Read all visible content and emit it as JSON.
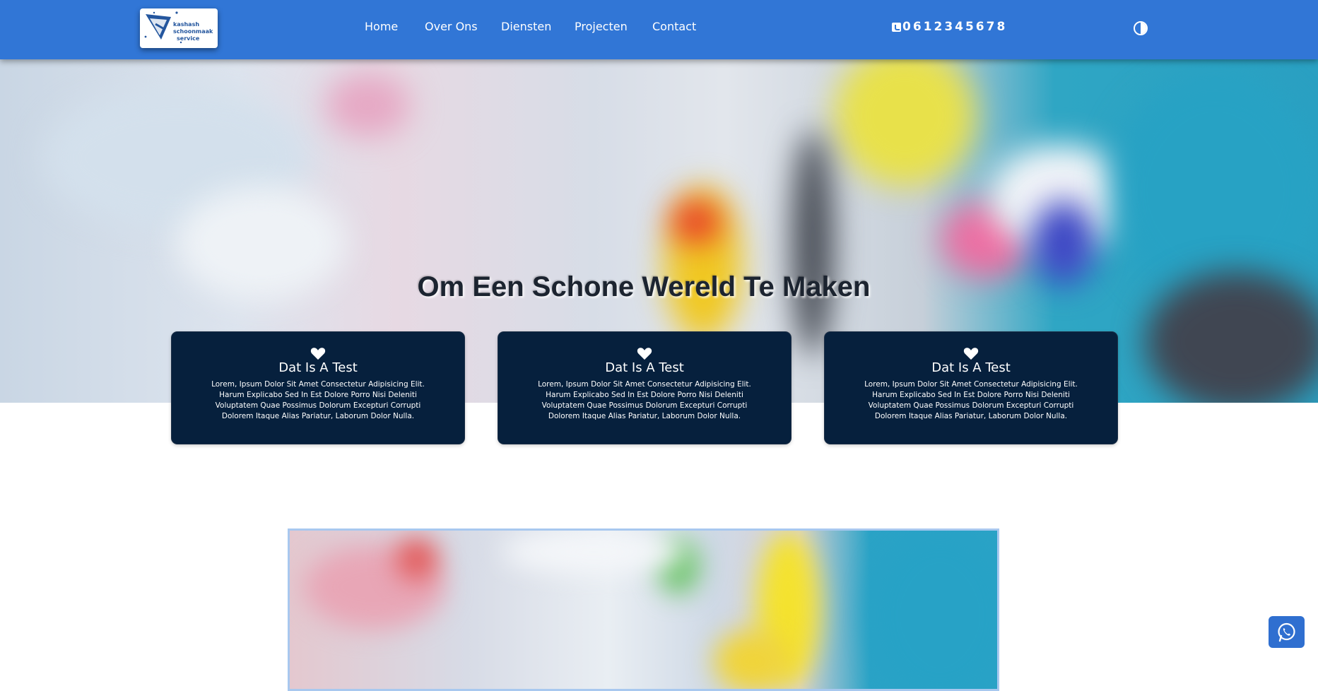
{
  "header": {
    "logo_lines": [
      "kashash",
      "schoonmaak",
      "service"
    ],
    "nav": [
      {
        "label": "Home"
      },
      {
        "label": "Over Ons"
      },
      {
        "label": "Diensten"
      },
      {
        "label": "Projecten"
      },
      {
        "label": "Contact"
      }
    ],
    "phone": "0612345678",
    "phone_icon": "phone-icon",
    "theme_toggle_icon": "contrast-icon"
  },
  "hero": {
    "title": "Om Een Schone Wereld Te Maken"
  },
  "cards": [
    {
      "icon": "heart-icon",
      "title": "Dat Is A Test",
      "text": "Lorem, Ipsum Dolor Sit Amet Consectetur Adipisicing Elit. Harum Explicabo Sed In Est Dolore Porro Nisi Deleniti Voluptatem Quae Possimus Dolorum Excepturi Corrupti Dolorem Itaque Alias Pariatur, Laborum Dolor Nulla."
    },
    {
      "icon": "heart-icon",
      "title": "Dat Is A Test",
      "text": "Lorem, Ipsum Dolor Sit Amet Consectetur Adipisicing Elit. Harum Explicabo Sed In Est Dolore Porro Nisi Deleniti Voluptatem Quae Possimus Dolorum Excepturi Corrupti Dolorem Itaque Alias Pariatur, Laborum Dolor Nulla."
    },
    {
      "icon": "heart-icon",
      "title": "Dat Is A Test",
      "text": "Lorem, Ipsum Dolor Sit Amet Consectetur Adipisicing Elit. Harum Explicabo Sed In Est Dolore Porro Nisi Deleniti Voluptatem Quae Possimus Dolorum Excepturi Corrupti Dolorem Itaque Alias Pariatur, Laborum Dolor Nulla."
    }
  ],
  "whatsapp": {
    "icon": "whatsapp-icon"
  },
  "colors": {
    "header_bg": "#3176d6",
    "card_bg": "#06203d",
    "accent": "#2f6fd0"
  }
}
